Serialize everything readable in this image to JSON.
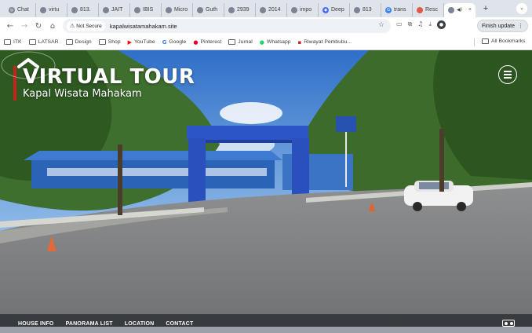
{
  "browser": {
    "tabs": [
      {
        "label": "Chat",
        "icon": "chatgpt-icon"
      },
      {
        "label": "virtu",
        "icon": "globe-icon"
      },
      {
        "label": "813.",
        "icon": "globe-icon"
      },
      {
        "label": "JAIT",
        "icon": "globe-icon"
      },
      {
        "label": "IBIS",
        "icon": "globe-icon"
      },
      {
        "label": "Micro",
        "icon": "globe-icon"
      },
      {
        "label": "Guth",
        "icon": "globe-icon"
      },
      {
        "label": "2939",
        "icon": "globe-icon"
      },
      {
        "label": "2014",
        "icon": "globe-icon"
      },
      {
        "label": "impo",
        "icon": "globe-icon"
      },
      {
        "label": "Deep",
        "icon": "deepseek-icon"
      },
      {
        "label": "813",
        "icon": "globe-icon"
      },
      {
        "label": "trans",
        "icon": "google-icon"
      },
      {
        "label": "Resc",
        "icon": "globe-icon"
      }
    ],
    "active_tab": {
      "close": "×"
    },
    "new_tab": "+",
    "tab_menu": "⌄",
    "security_chip": "Not Secure",
    "url": "kapalwisatamahakam.site",
    "finish_update": "Finish update",
    "bookmarks": [
      {
        "label": "ITK",
        "kind": "folder"
      },
      {
        "label": "LATSAR",
        "kind": "folder"
      },
      {
        "label": "Design",
        "kind": "folder"
      },
      {
        "label": "Shop",
        "kind": "folder"
      },
      {
        "label": "YouTube",
        "kind": "youtube"
      },
      {
        "label": "Google",
        "kind": "google"
      },
      {
        "label": "Pinterest",
        "kind": "pinterest"
      },
      {
        "label": "Jurnal",
        "kind": "folder"
      },
      {
        "label": "Whatsapp",
        "kind": "whatsapp"
      },
      {
        "label": "Riwayat Pembubu...",
        "kind": "site"
      }
    ],
    "all_bookmarks": "All Bookmarks"
  },
  "page": {
    "title": "VIRTUAL TOUR",
    "subtitle": "Kapal Wisata Mahakam",
    "bottom_nav": [
      "HOUSE INFO",
      "PANORAMA LIST",
      "LOCATION",
      "CONTACT"
    ]
  },
  "colors": {
    "brand_accent": "#c0261e",
    "gate_blue": "#2c56c8"
  }
}
